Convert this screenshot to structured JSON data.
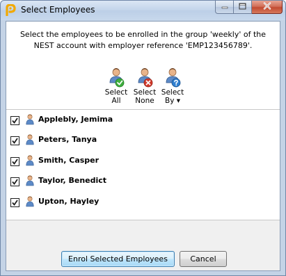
{
  "window": {
    "title": "Select Employees",
    "app_icon": "nest-logo-icon",
    "controls": [
      "minimize-icon",
      "maximize-icon",
      "close-icon"
    ]
  },
  "instruction": "Select the employees to be enrolled in the group 'weekly' of the\nNEST account with employer reference 'EMP123456789'.",
  "toolbar": {
    "select_all": {
      "label": "Select\nAll",
      "icon": "users-check-icon"
    },
    "select_none": {
      "label": "Select\nNone",
      "icon": "users-cross-icon"
    },
    "select_by": {
      "label": "Select\nBy ▾",
      "icon": "users-question-icon"
    }
  },
  "employees": [
    {
      "name": "Applebly, Jemima",
      "checked": true
    },
    {
      "name": "Peters, Tanya",
      "checked": true
    },
    {
      "name": "Smith, Casper",
      "checked": true
    },
    {
      "name": "Taylor, Benedict",
      "checked": true
    },
    {
      "name": "Upton, Hayley",
      "checked": true
    }
  ],
  "buttons": {
    "enrol": "Enrol Selected Employees",
    "cancel": "Cancel"
  },
  "colors": {
    "accent": "#3c7fb1",
    "select_all_badge": "#3fae3f",
    "select_none_badge": "#d33a2c",
    "select_by_badge": "#2f7fd0",
    "app_icon": "#f2a900"
  }
}
